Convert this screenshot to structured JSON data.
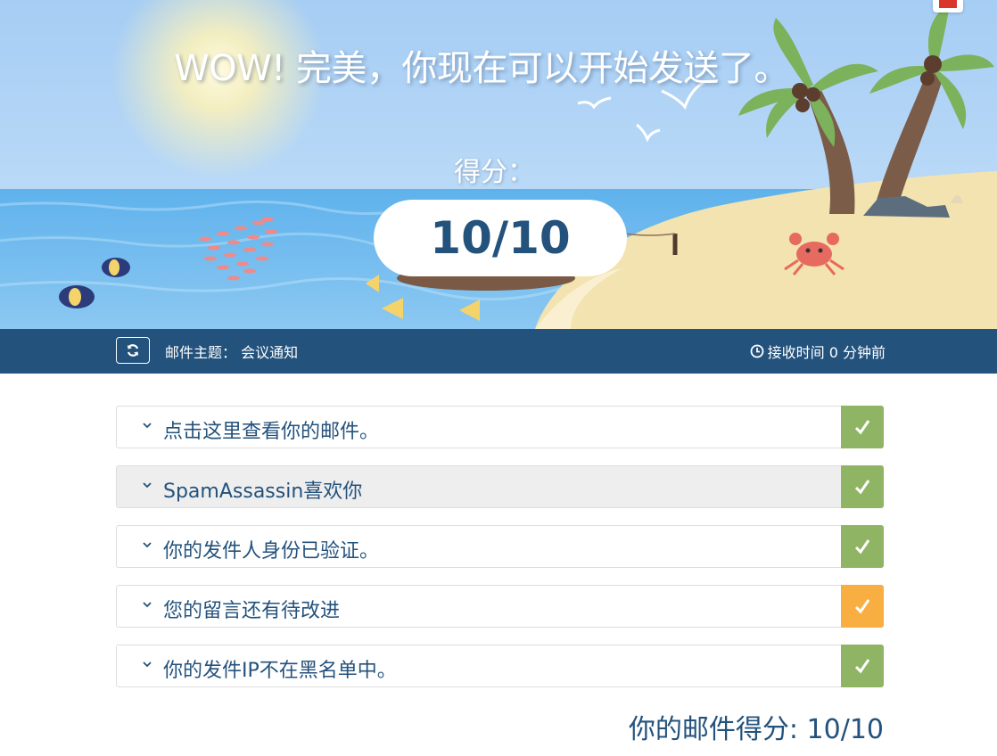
{
  "hero": {
    "title": "WOW! 完美，你现在可以开始发送了。",
    "score_label": "得分：",
    "score_value": "10/10"
  },
  "info_bar": {
    "refresh_icon": "refresh-icon",
    "subject_label": "邮件主题：",
    "subject_value": "会议通知",
    "received_icon": "clock-icon",
    "received_text": "接收时间 0 分钟前"
  },
  "checks": [
    {
      "label": "点击这里查看你的邮件。",
      "status": "pass",
      "color": "#8fb564"
    },
    {
      "label": "SpamAssassin喜欢你",
      "status": "pass",
      "color": "#8fb564"
    },
    {
      "label": "你的发件人身份已验证。",
      "status": "pass",
      "color": "#8fb564"
    },
    {
      "label": "您的留言还有待改进",
      "status": "warning",
      "color": "#f9ae42"
    },
    {
      "label": "你的发件IP不在黑名单中。",
      "status": "pass",
      "color": "#8fb564"
    }
  ],
  "total": "你的邮件得分: 10/10",
  "colors": {
    "primary": "#23527c",
    "pass": "#8fb564",
    "warning": "#f9ae42",
    "sky": "#aed3f6",
    "sand": "#f3e3b0"
  }
}
